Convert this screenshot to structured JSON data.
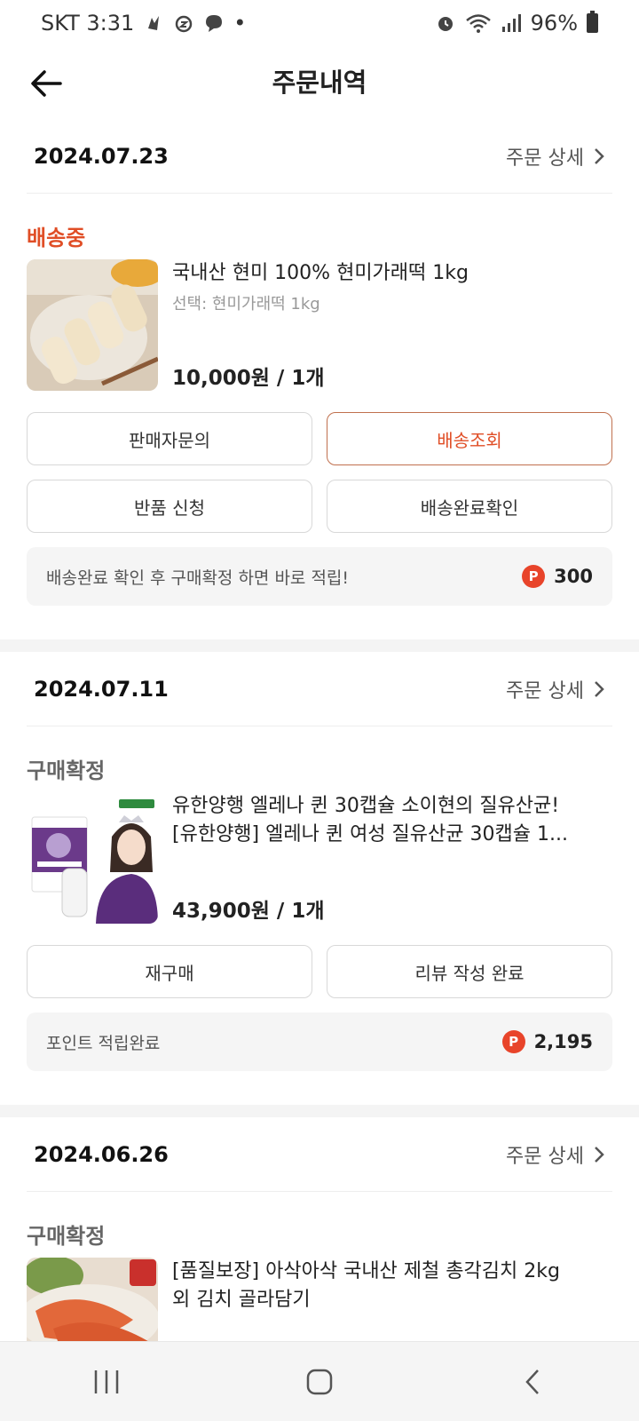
{
  "statusbar": {
    "carrier_time": "SKT 3:31",
    "dot": "•",
    "battery": "96%"
  },
  "header": {
    "title": "주문내역"
  },
  "detail_label": "주문 상세",
  "orders": [
    {
      "date": "2024.07.23",
      "status": "배송중",
      "product_name": "국내산 현미 100% 현미가래떡 1kg",
      "product_option": "선택: 현미가래떡 1kg",
      "price": "10,000원 / 1개",
      "buttons": [
        "판매자문의",
        "배송조회",
        "반품 신청",
        "배송완료확인"
      ],
      "point_text": "배송완료 확인 후 구매확정 하면 바로 적립!",
      "point_value": "300"
    },
    {
      "date": "2024.07.11",
      "status": "구매확정",
      "product_name": "유한양행 엘레나 퀸 30캡슐 소이현의 질유산균!",
      "product_name2": "[유한양행] 엘레나 퀸 여성 질유산균 30캡슐 1...",
      "price": "43,900원 / 1개",
      "buttons": [
        "재구매",
        "리뷰 작성 완료"
      ],
      "point_text": "포인트 적립완료",
      "point_value": "2,195"
    },
    {
      "date": "2024.06.26",
      "status": "구매확정",
      "product_name": "[품질보장] 아삭아삭 국내산 제철 총각김치 2kg",
      "product_name2": "외 김치 골라담기"
    }
  ],
  "point_icon_letter": "P",
  "colors": {
    "accent": "#e04e26",
    "point": "#e8442a"
  }
}
